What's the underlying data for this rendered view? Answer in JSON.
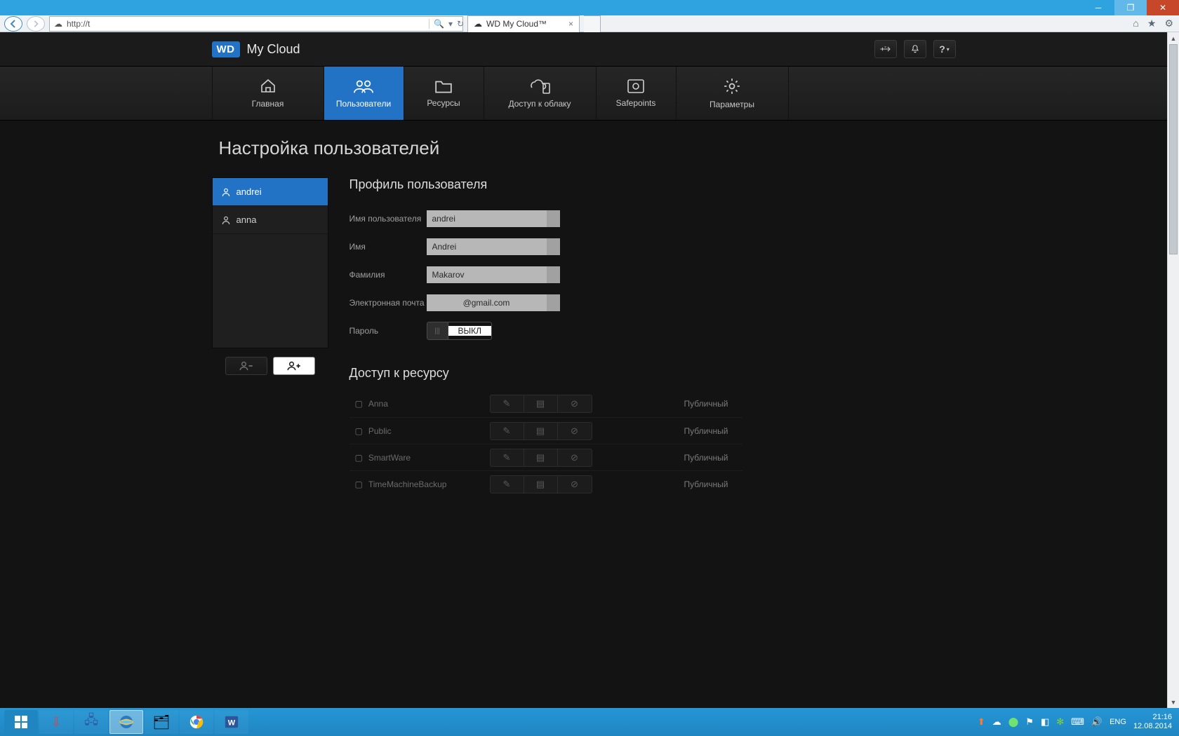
{
  "window": {
    "url_prefix": "http://t"
  },
  "browser_tab": {
    "title": "WD My Cloud™"
  },
  "brand": {
    "logo": "WD",
    "name": "My Cloud"
  },
  "nav": {
    "home": "Главная",
    "users": "Пользователи",
    "shares": "Ресурсы",
    "cloud": "Доступ к облаку",
    "safepoints": "Safepoints",
    "settings": "Параметры"
  },
  "page_title": "Настройка пользователей",
  "user_list": {
    "items": [
      {
        "name": "andrei",
        "active": true
      },
      {
        "name": "anna",
        "active": false
      }
    ]
  },
  "profile": {
    "heading": "Профиль пользователя",
    "labels": {
      "username": "Имя пользователя",
      "firstname": "Имя",
      "lastname": "Фамилия",
      "email": "Электронная почта",
      "password": "Пароль"
    },
    "values": {
      "username": "andrei",
      "firstname": "Andrei",
      "lastname": "Makarov",
      "email": "@gmail.com"
    },
    "password_toggle": "ВЫКЛ"
  },
  "access": {
    "heading": "Доступ к ресурсу",
    "status_label": "Публичный",
    "items": [
      {
        "name": "Anna"
      },
      {
        "name": "Public"
      },
      {
        "name": "SmartWare"
      },
      {
        "name": "TimeMachineBackup"
      }
    ]
  },
  "tray": {
    "lang": "ENG",
    "time": "21:16",
    "date": "12.08.2014"
  }
}
